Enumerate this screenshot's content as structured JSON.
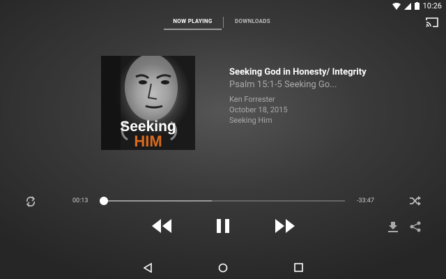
{
  "status_bar": {
    "time": "10:26"
  },
  "tabs": [
    {
      "label": "NOW PLAYING",
      "selected": true
    },
    {
      "label": "DOWNLOADS",
      "selected": false
    }
  ],
  "album_art": {
    "line1": "Seeking",
    "line2": "HIM"
  },
  "track": {
    "title": "Seeking God in Honesty/ Integrity",
    "subtitle": "Psalm 15:1-5 Seeking Go...",
    "author": "Ken Forrester",
    "date": "October 18, 2015",
    "series": "Seeking Him"
  },
  "player": {
    "elapsed": "00:13",
    "remaining": "-33:47",
    "progress": 0.006,
    "buffered": 0.45
  },
  "icons": [
    "wifi-icon",
    "signal-icon",
    "battery-icon",
    "cast-icon",
    "repeat-icon",
    "shuffle-icon",
    "rewind-icon",
    "pause-icon",
    "fast-forward-icon",
    "download-icon",
    "share-icon",
    "back-icon",
    "home-icon",
    "recent-apps-icon"
  ]
}
